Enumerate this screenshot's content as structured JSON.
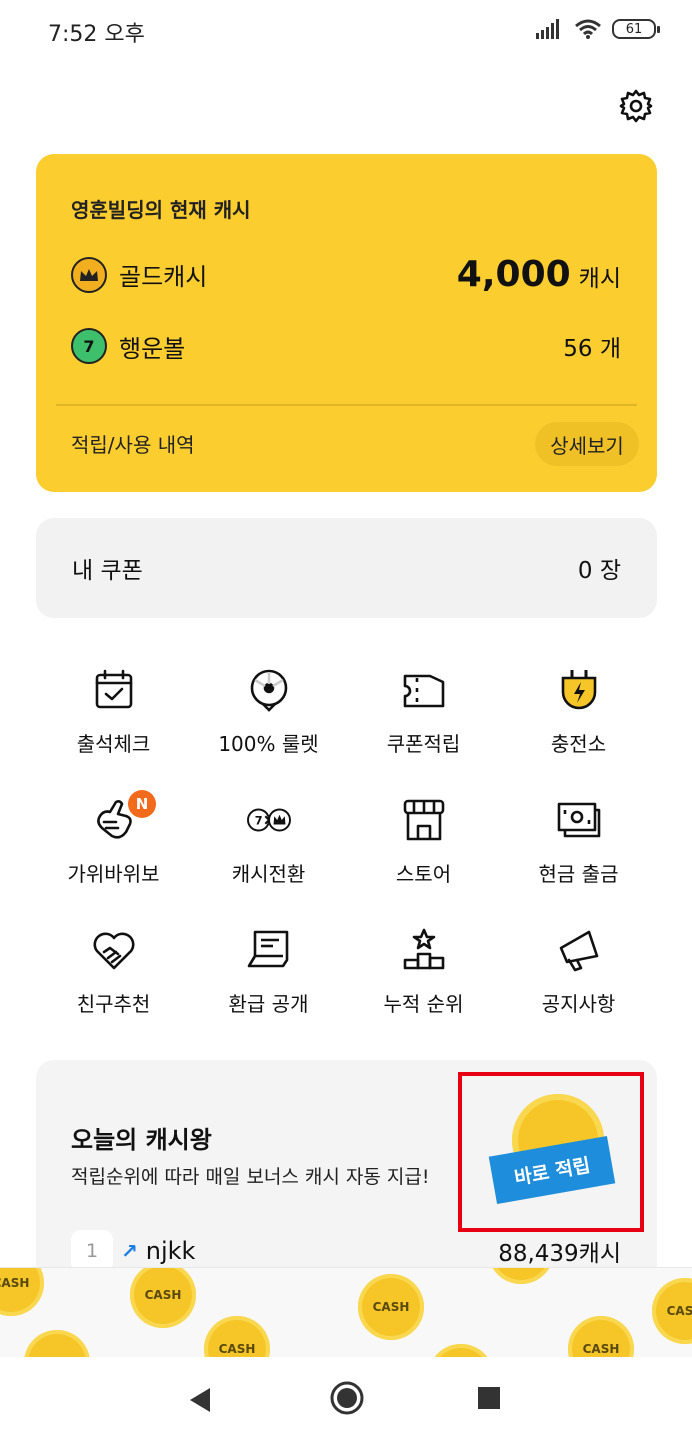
{
  "status_bar": {
    "time": "7:52 오후",
    "battery": "61",
    "icons": [
      "signal-icon",
      "wifi-icon",
      "battery-icon"
    ]
  },
  "header": {
    "settings_icon": "gear-icon"
  },
  "cash_card": {
    "title": "영훈빌딩의 현재 캐시",
    "gold_label": "골드캐시",
    "gold_amount": "4,000",
    "gold_unit": "캐시",
    "luck_label": "행운볼",
    "luck_icon_text": "7",
    "luck_value": "56 개",
    "history_label": "적립/사용 내역",
    "detail_button": "상세보기",
    "background_color": "#FCCD2E"
  },
  "coupon": {
    "label": "내 쿠폰",
    "value": "0 장"
  },
  "menu": {
    "items": [
      {
        "label": "출석체크",
        "icon": "calendar-check-icon"
      },
      {
        "label": "100% 룰렛",
        "icon": "roulette-icon"
      },
      {
        "label": "쿠폰적립",
        "icon": "ticket-icon"
      },
      {
        "label": "충전소",
        "icon": "charging-plug-icon"
      },
      {
        "label": "가위바위보",
        "icon": "hand-gesture-icon",
        "badge": "N"
      },
      {
        "label": "캐시전환",
        "icon": "cash-exchange-icon"
      },
      {
        "label": "스토어",
        "icon": "store-icon"
      },
      {
        "label": "현금 출금",
        "icon": "cash-bills-icon"
      },
      {
        "label": "친구추천",
        "icon": "heart-handshake-icon"
      },
      {
        "label": "환급 공개",
        "icon": "refund-card-icon"
      },
      {
        "label": "누적 순위",
        "icon": "podium-star-icon"
      },
      {
        "label": "공지사항",
        "icon": "megaphone-icon"
      }
    ]
  },
  "cash_king": {
    "title": "오늘의 캐시왕",
    "subtitle": "적립순위에 따라 매일 보너스 캐시 자동 지급!",
    "earn_button": "바로 적립",
    "rank": {
      "number": "1",
      "name": "njkk",
      "cash": "88,439캐시"
    }
  },
  "coin_strip": {
    "coin_text": "CASH"
  },
  "nav_bar": {
    "buttons": [
      "back-icon",
      "home-icon",
      "recents-icon"
    ]
  }
}
